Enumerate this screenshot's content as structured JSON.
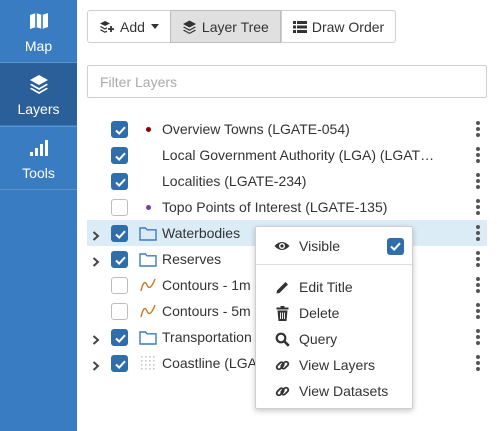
{
  "nav": {
    "items": [
      {
        "label": "Map",
        "icon": "map-icon"
      },
      {
        "label": "Layers",
        "icon": "layers-icon"
      },
      {
        "label": "Tools",
        "icon": "signal-bars-icon"
      }
    ],
    "active": "Layers"
  },
  "toolbar": {
    "add_label": "Add",
    "layer_tree_label": "Layer Tree",
    "draw_order_label": "Draw Order",
    "active": "Layer Tree"
  },
  "filter": {
    "placeholder": "Filter Layers",
    "value": ""
  },
  "layers": [
    {
      "label": "Overview Towns (LGATE-054)",
      "checked": true,
      "icon": "dot",
      "dot_color": "#8b0000",
      "expandable": false
    },
    {
      "label": "Local Government Authority (LGA) (LGAT…",
      "checked": true,
      "icon": "none",
      "expandable": false
    },
    {
      "label": "Localities (LGATE-234)",
      "checked": true,
      "icon": "none",
      "expandable": false
    },
    {
      "label": "Topo Points of Interest (LGATE-135)",
      "checked": false,
      "icon": "dot",
      "dot_color": "#7b3fa0",
      "expandable": false
    },
    {
      "label": "Waterbodies",
      "checked": true,
      "icon": "folder",
      "expandable": true,
      "highlighted": true
    },
    {
      "label": "Reserves",
      "checked": true,
      "icon": "folder",
      "expandable": true
    },
    {
      "label": "Contours - 1m",
      "checked": false,
      "icon": "line",
      "expandable": false
    },
    {
      "label": "Contours - 5m",
      "checked": false,
      "icon": "line",
      "expandable": false
    },
    {
      "label": "Transportation",
      "checked": true,
      "icon": "folder",
      "expandable": true
    },
    {
      "label": "Coastline (LGA",
      "checked": true,
      "icon": "grid",
      "expandable": true
    }
  ],
  "context_menu": {
    "visible": {
      "label": "Visible",
      "checked": true
    },
    "items": [
      {
        "label": "Edit Title",
        "icon": "pencil-icon"
      },
      {
        "label": "Delete",
        "icon": "trash-icon"
      },
      {
        "label": "Query",
        "icon": "search-icon"
      },
      {
        "label": "View Layers",
        "icon": "link-icon"
      },
      {
        "label": "View Datasets",
        "icon": "link-icon"
      }
    ]
  },
  "colors": {
    "nav_bg": "#3a7cc1",
    "nav_active": "#2a5f99",
    "checkbox": "#2f6dab",
    "highlight_row": "#dcecf7",
    "folder": "#3a7cc1",
    "contour_line": "#c8791d"
  }
}
